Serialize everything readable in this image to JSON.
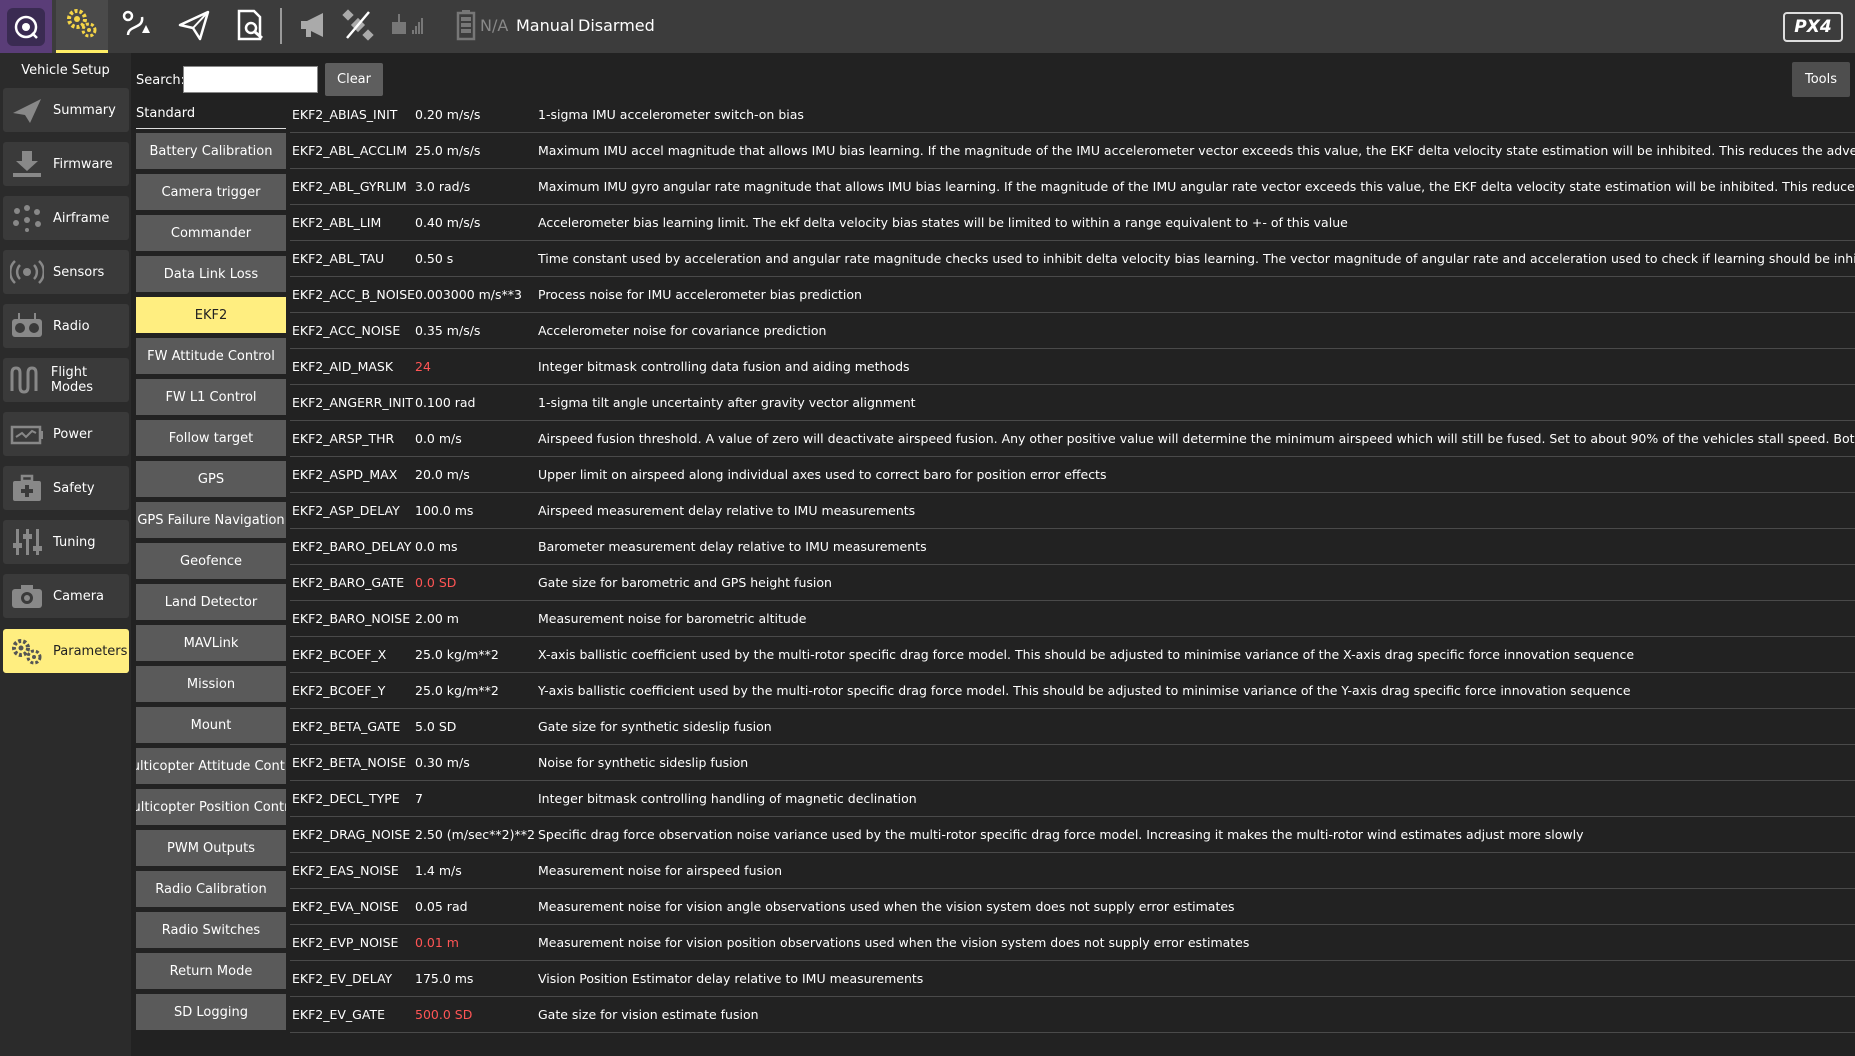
{
  "toolbar": {
    "battery_text": "N/A",
    "flight_mode": "Manual",
    "arm_state": "Disarmed",
    "brand_logo": "PX4"
  },
  "setup": {
    "title": "Vehicle Setup",
    "items": [
      {
        "label": "Summary",
        "icon": "paper-plane-icon"
      },
      {
        "label": "Firmware",
        "icon": "download-icon"
      },
      {
        "label": "Airframe",
        "icon": "airframe-icon"
      },
      {
        "label": "Sensors",
        "icon": "sensors-icon"
      },
      {
        "label": "Radio",
        "icon": "radio-icon"
      },
      {
        "label": "Flight Modes",
        "icon": "flight-modes-icon"
      },
      {
        "label": "Power",
        "icon": "power-icon"
      },
      {
        "label": "Safety",
        "icon": "safety-icon"
      },
      {
        "label": "Tuning",
        "icon": "tuning-icon"
      },
      {
        "label": "Camera",
        "icon": "camera-icon"
      },
      {
        "label": "Parameters",
        "icon": "gears-icon"
      }
    ]
  },
  "search": {
    "label": "Search:",
    "value": "",
    "clear_label": "Clear",
    "tools_label": "Tools"
  },
  "groups": {
    "header": "Standard",
    "active": "EKF2",
    "items": [
      "Battery Calibration",
      "Camera trigger",
      "Commander",
      "Data Link Loss",
      "EKF2",
      "FW Attitude Control",
      "FW L1 Control",
      "Follow target",
      "GPS",
      "GPS Failure Navigation",
      "Geofence",
      "Land Detector",
      "MAVLink",
      "Mission",
      "Mount",
      "Multicopter Attitude Control",
      "Multicopter Position Control",
      "PWM Outputs",
      "Radio Calibration",
      "Radio Switches",
      "Return Mode",
      "SD Logging"
    ]
  },
  "params": [
    {
      "name": "EKF2_ABIAS_INIT",
      "value": "0.20 m/s/s",
      "modified": false,
      "desc": "1-sigma IMU accelerometer switch-on bias"
    },
    {
      "name": "EKF2_ABL_ACCLIM",
      "value": "25.0 m/s/s",
      "modified": false,
      "desc": "Maximum IMU accel magnitude that allows IMU bias learning. If the magnitude of the IMU accelerometer vector exceeds this value, the EKF delta velocity state estimation will be inhibited. This reduces the adverse effect of high manoeuv"
    },
    {
      "name": "EKF2_ABL_GYRLIM",
      "value": "3.0 rad/s",
      "modified": false,
      "desc": "Maximum IMU gyro angular rate magnitude that allows IMU bias learning. If the magnitude of the IMU angular rate vector exceeds this value, the EKF delta velocity state estimation will be inhibited. This reduces the adverse effect of rapi"
    },
    {
      "name": "EKF2_ABL_LIM",
      "value": "0.40 m/s/s",
      "modified": false,
      "desc": "Accelerometer bias learning limit. The ekf delta velocity bias states will be limited to within a range equivalent to +- of this value"
    },
    {
      "name": "EKF2_ABL_TAU",
      "value": "0.50 s",
      "modified": false,
      "desc": "Time constant used by acceleration and angular rate magnitude checks used to inhibit delta velocity bias learning. The vector magnitude of angular rate and acceleration used to check if learning should be inhibited has a peak hold filter"
    },
    {
      "name": "EKF2_ACC_B_NOISE",
      "value": "0.003000 m/s**3",
      "modified": false,
      "desc": "Process noise for IMU accelerometer bias prediction"
    },
    {
      "name": "EKF2_ACC_NOISE",
      "value": "0.35 m/s/s",
      "modified": false,
      "desc": "Accelerometer noise for covariance prediction"
    },
    {
      "name": "EKF2_AID_MASK",
      "value": "24",
      "modified": true,
      "desc": "Integer bitmask controlling data fusion and aiding methods"
    },
    {
      "name": "EKF2_ANGERR_INIT",
      "value": "0.100 rad",
      "modified": false,
      "desc": "1-sigma tilt angle uncertainty after gravity vector alignment"
    },
    {
      "name": "EKF2_ARSP_THR",
      "value": "0.0 m/s",
      "modified": false,
      "desc": "Airspeed fusion threshold. A value of zero will deactivate airspeed fusion. Any other positive value will determine the minimum airspeed which will still be fused. Set to about 90% of the vehicles stall speed. Both airspeed fusion and sides"
    },
    {
      "name": "EKF2_ASPD_MAX",
      "value": "20.0 m/s",
      "modified": false,
      "desc": "Upper limit on airspeed along individual axes used to correct baro for position error effects"
    },
    {
      "name": "EKF2_ASP_DELAY",
      "value": "100.0 ms",
      "modified": false,
      "desc": "Airspeed measurement delay relative to IMU measurements"
    },
    {
      "name": "EKF2_BARO_DELAY",
      "value": "0.0 ms",
      "modified": false,
      "desc": "Barometer measurement delay relative to IMU measurements"
    },
    {
      "name": "EKF2_BARO_GATE",
      "value": "0.0 SD",
      "modified": true,
      "desc": "Gate size for barometric and GPS height fusion"
    },
    {
      "name": "EKF2_BARO_NOISE",
      "value": "2.00 m",
      "modified": false,
      "desc": "Measurement noise for barometric altitude"
    },
    {
      "name": "EKF2_BCOEF_X",
      "value": "25.0 kg/m**2",
      "modified": false,
      "desc": "X-axis ballistic coefficient used by the multi-rotor specific drag force model. This should be adjusted to minimise variance of the X-axis drag specific force innovation sequence"
    },
    {
      "name": "EKF2_BCOEF_Y",
      "value": "25.0 kg/m**2",
      "modified": false,
      "desc": "Y-axis ballistic coefficient used by the multi-rotor specific drag force model. This should be adjusted to minimise variance of the Y-axis drag specific force innovation sequence"
    },
    {
      "name": "EKF2_BETA_GATE",
      "value": "5.0 SD",
      "modified": false,
      "desc": "Gate size for synthetic sideslip fusion"
    },
    {
      "name": "EKF2_BETA_NOISE",
      "value": "0.30 m/s",
      "modified": false,
      "desc": "Noise for synthetic sideslip fusion"
    },
    {
      "name": "EKF2_DECL_TYPE",
      "value": "7",
      "modified": false,
      "desc": "Integer bitmask controlling handling of magnetic declination"
    },
    {
      "name": "EKF2_DRAG_NOISE",
      "value": "2.50 (m/sec**2)**2",
      "modified": false,
      "desc": "Specific drag force observation noise variance used by the multi-rotor specific drag force model. Increasing it makes the multi-rotor wind estimates adjust more slowly"
    },
    {
      "name": "EKF2_EAS_NOISE",
      "value": "1.4 m/s",
      "modified": false,
      "desc": "Measurement noise for airspeed fusion"
    },
    {
      "name": "EKF2_EVA_NOISE",
      "value": "0.05 rad",
      "modified": false,
      "desc": "Measurement noise for vision angle observations used when the vision system does not supply error estimates"
    },
    {
      "name": "EKF2_EVP_NOISE",
      "value": "0.01 m",
      "modified": true,
      "desc": "Measurement noise for vision position observations used when the vision system does not supply error estimates"
    },
    {
      "name": "EKF2_EV_DELAY",
      "value": "175.0 ms",
      "modified": false,
      "desc": "Vision Position Estimator delay relative to IMU measurements"
    },
    {
      "name": "EKF2_EV_GATE",
      "value": "500.0 SD",
      "modified": true,
      "desc": "Gate size for vision estimate fusion"
    }
  ],
  "colors": {
    "accent": "#ffee80",
    "modified_value": "#ff5555",
    "toolbar_bg": "#3c3c3c",
    "app_button_bg": "#5a3d78"
  }
}
